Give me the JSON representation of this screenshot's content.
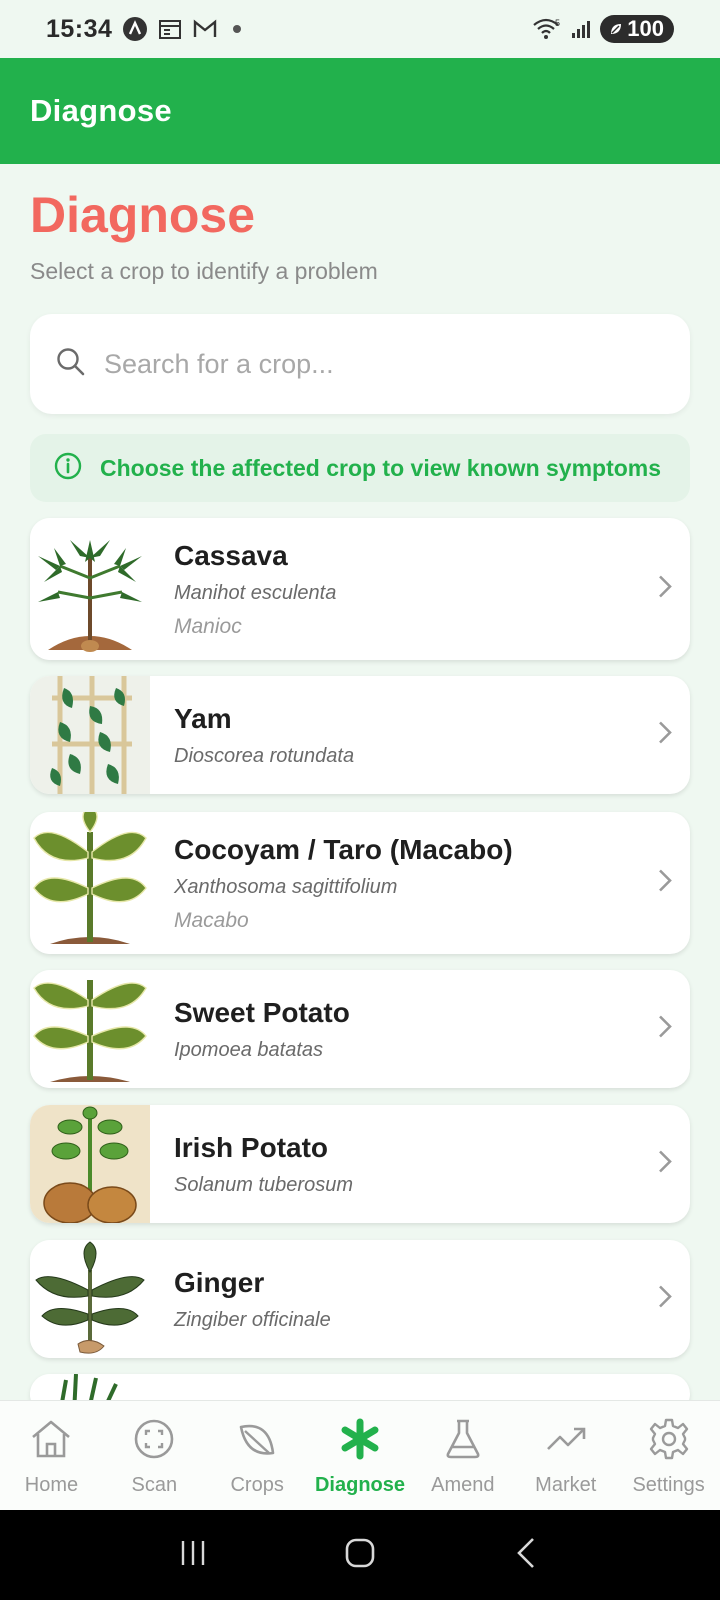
{
  "status_bar": {
    "time": "15:34",
    "battery": "100",
    "wifi_badge": "5",
    "icons": [
      "a-circle-icon",
      "calendar-icon",
      "gmail-icon",
      "dot-icon",
      "wifi-icon",
      "signal-icon",
      "battery-icon"
    ]
  },
  "app_bar": {
    "title": "Diagnose"
  },
  "header": {
    "title": "Diagnose",
    "subtitle": "Select a crop to identify a problem"
  },
  "search": {
    "placeholder": "Search for a crop...",
    "value": ""
  },
  "info_banner": {
    "text": "Choose the affected crop to view known symptoms"
  },
  "crops": [
    {
      "name": "Cassava",
      "scientific": "Manihot esculenta",
      "local": "Manioc"
    },
    {
      "name": "Yam",
      "scientific": "Dioscorea rotundata"
    },
    {
      "name": "Cocoyam / Taro (Macabo)",
      "scientific": "Xanthosoma sagittifolium",
      "local": "Macabo"
    },
    {
      "name": "Sweet Potato",
      "scientific": "Ipomoea batatas"
    },
    {
      "name": "Irish Potato",
      "scientific": "Solanum tuberosum"
    },
    {
      "name": "Ginger",
      "scientific": "Zingiber officinale"
    }
  ],
  "bottom_nav": {
    "items": [
      {
        "label": "Home",
        "icon": "home-icon"
      },
      {
        "label": "Scan",
        "icon": "scan-icon"
      },
      {
        "label": "Crops",
        "icon": "leaf-icon"
      },
      {
        "label": "Diagnose",
        "icon": "asterisk-icon"
      },
      {
        "label": "Amend",
        "icon": "flask-icon"
      },
      {
        "label": "Market",
        "icon": "trending-up-icon"
      },
      {
        "label": "Settings",
        "icon": "gear-icon"
      }
    ],
    "active": "Diagnose"
  },
  "colors": {
    "brand_green": "#22b14c",
    "title_coral": "#f2685f",
    "background": "#eff8f1"
  }
}
